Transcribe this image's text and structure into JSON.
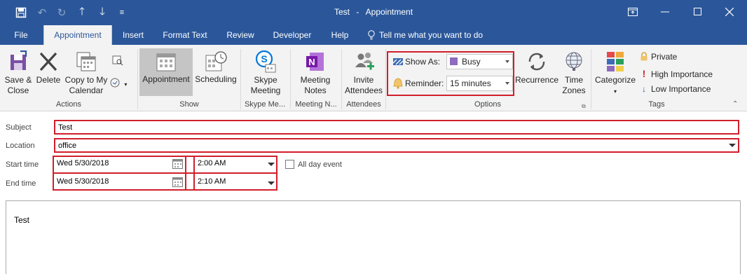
{
  "window": {
    "title_left": "Test",
    "title_sep": "-",
    "title_right": "Appointment"
  },
  "tabs": [
    "File",
    "Appointment",
    "Insert",
    "Format Text",
    "Review",
    "Developer",
    "Help"
  ],
  "tell_me": "Tell me what you want to do",
  "ribbon": {
    "actions": {
      "save_close": [
        "Save &",
        "Close"
      ],
      "delete": "Delete",
      "copy_calendar": [
        "Copy to My",
        "Calendar"
      ],
      "label": "Actions"
    },
    "show": {
      "appointment": "Appointment",
      "scheduling": "Scheduling",
      "label": "Show"
    },
    "skype": {
      "button": [
        "Skype",
        "Meeting"
      ],
      "label": "Skype Me..."
    },
    "meeting_notes": {
      "button": [
        "Meeting",
        "Notes"
      ],
      "label": "Meeting N..."
    },
    "attendees": {
      "button": [
        "Invite",
        "Attendees"
      ],
      "label": "Attendees"
    },
    "options": {
      "show_as_label": "Show As:",
      "show_as_value": "Busy",
      "reminder_label": "Reminder:",
      "reminder_value": "15 minutes",
      "recurrence": "Recurrence",
      "time_zones": [
        "Time",
        "Zones"
      ],
      "label": "Options"
    },
    "tags": {
      "categorize": "Categorize",
      "private": "Private",
      "high_importance": "High Importance",
      "low_importance": "Low Importance",
      "label": "Tags"
    }
  },
  "form": {
    "subject_label": "Subject",
    "subject_value": "Test",
    "location_label": "Location",
    "location_value": "office",
    "start_label": "Start time",
    "start_date": "Wed 5/30/2018",
    "start_time": "2:00 AM",
    "end_label": "End time",
    "end_date": "Wed 5/30/2018",
    "end_time": "2:10 AM",
    "all_day": "All day event"
  },
  "body_text": "Test",
  "colors": {
    "accent": "#2b579a",
    "highlight_box": "#d01f2b",
    "busy_swatch": "#8e6bbf"
  },
  "icons": [
    "save-icon",
    "undo-icon",
    "redo-icon",
    "up-arrow-icon",
    "down-arrow-icon",
    "customize-icon",
    "lightbulb-icon",
    "calendar-picker-icon"
  ]
}
